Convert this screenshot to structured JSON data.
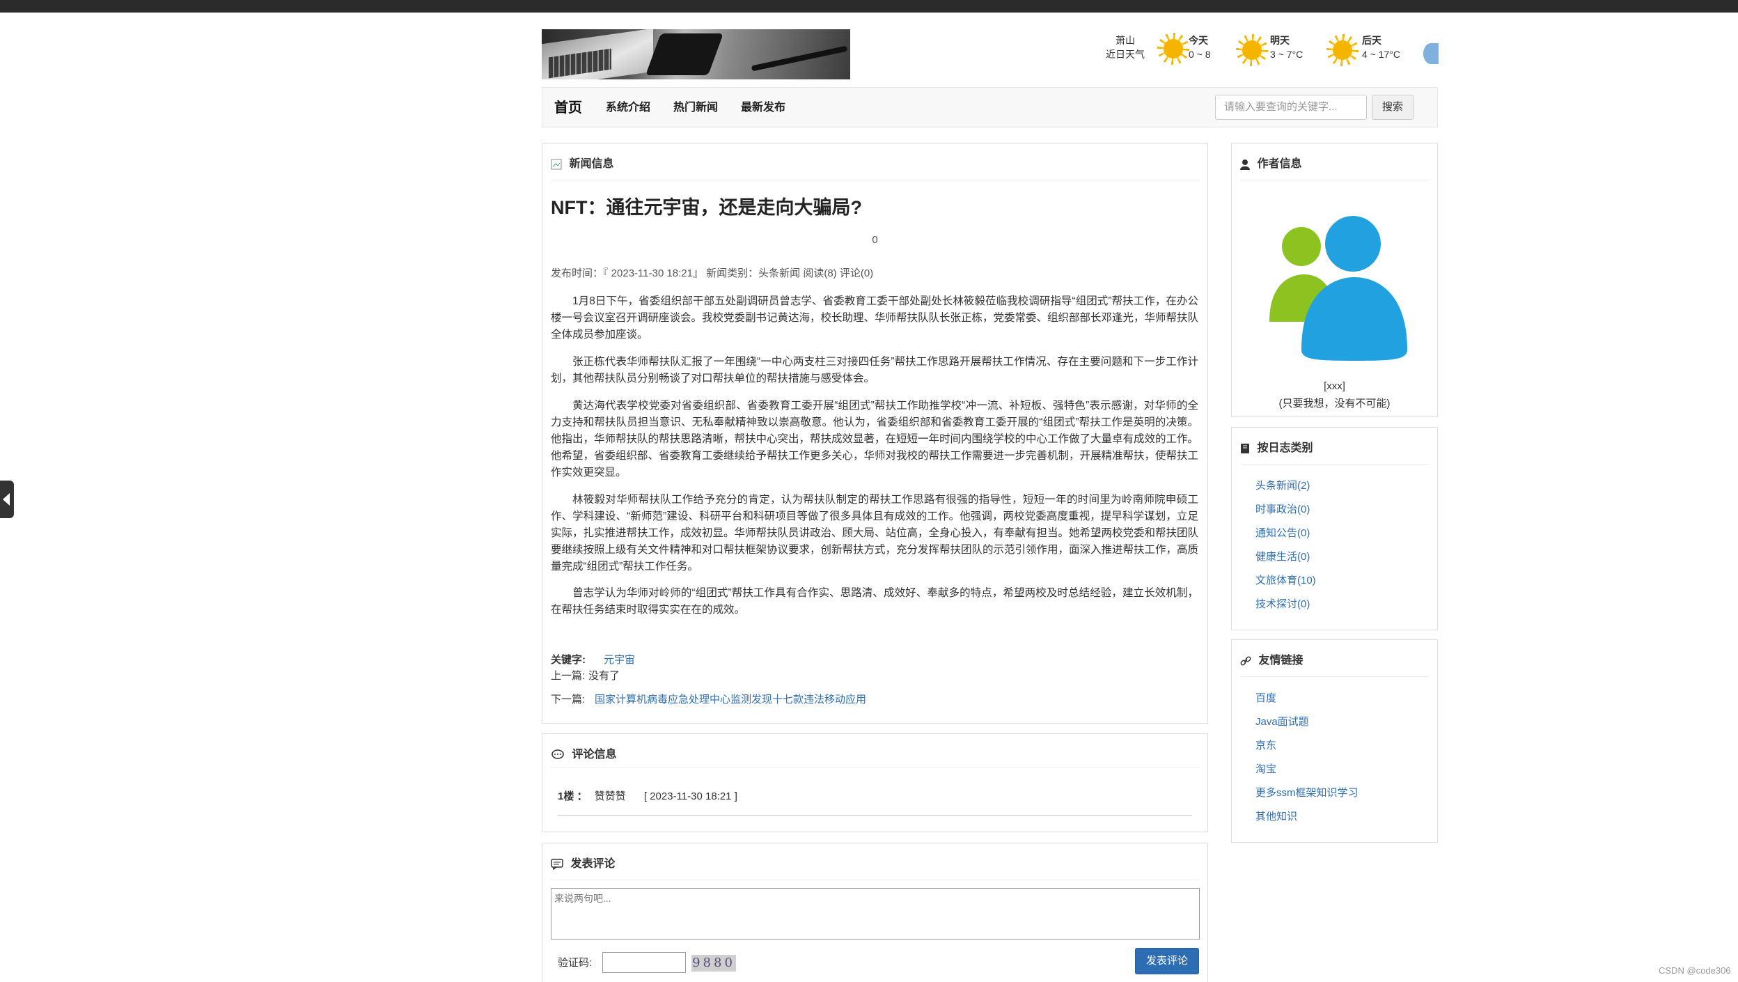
{
  "banner": {
    "alt": "laptop-phone-pen-banner"
  },
  "weather": {
    "city": "萧山",
    "city_sub": "近日天气",
    "days": [
      {
        "label": "今天",
        "temp": "0 ~ 8",
        "icon": "sun-icon"
      },
      {
        "label": "明天",
        "temp": "3 ~ 7°C",
        "icon": "sun-icon"
      },
      {
        "label": "后天",
        "temp": "4 ~ 17°C",
        "icon": "sun-icon"
      }
    ]
  },
  "nav": {
    "items": [
      "首页",
      "系统介绍",
      "热门新闻",
      "最新发布"
    ],
    "search_placeholder": "请输入要查询的关键字...",
    "search_button": "搜索"
  },
  "news": {
    "section_title": "新闻信息",
    "title": "NFT：通往元宇宙，还是走向大骗局?",
    "view_count": "0",
    "meta": "发布时间：『 2023-11-30 18:21』  新闻类别：头条新闻  阅读(8) 评论(0)",
    "paragraphs": [
      "1月8日下午，省委组织部干部五处副调研员曾志学、省委教育工委干部处副处长林筱毅莅临我校调研指导“组团式”帮扶工作，在办公楼一号会议室召开调研座谈会。我校党委副书记黄达海，校长助理、华师帮扶队队长张正栋，党委常委、组织部部长邓逢光，华师帮扶队全体成员参加座谈。",
      "张正栋代表华师帮扶队汇报了一年围绕“一中心两支柱三对接四任务”帮扶工作思路开展帮扶工作情况、存在主要问题和下一步工作计划，其他帮扶队员分别畅谈了对口帮扶单位的帮扶措施与感受体会。",
      "黄达海代表学校党委对省委组织部、省委教育工委开展“组团式”帮扶工作助推学校“冲一流、补短板、强特色”表示感谢，对华师的全力支持和帮扶队员担当意识、无私奉献精神致以崇高敬意。他认为，省委组织部和省委教育工委开展的“组团式”帮扶工作是英明的决策。他指出，华师帮扶队的帮扶思路清晰，帮扶中心突出，帮扶成效显著，在短短一年时间内围绕学校的中心工作做了大量卓有成效的工作。他希望，省委组织部、省委教育工委继续给予帮扶工作更多关心，华师对我校的帮扶工作需要进一步完善机制，开展精准帮扶，使帮扶工作实效更突显。",
      "林筱毅对华师帮扶队工作给予充分的肯定，认为帮扶队制定的帮扶工作思路有很强的指导性，短短一年的时间里为岭南师院申硕工作、学科建设、“新师范”建设、科研平台和科研项目等做了很多具体且有成效的工作。他强调，两校党委高度重视，提早科学谋划，立足实际，扎实推进帮扶工作，成效初显。华师帮扶队员讲政治、顾大局、站位高，全身心投入，有奉献有担当。她希望两校党委和帮扶团队要继续按照上级有关文件精神和对口帮扶框架协议要求，创新帮扶方式，充分发挥帮扶团队的示范引领作用，面深入推进帮扶工作，高质量完成“组团式”帮扶工作任务。",
      "曾志学认为华师对岭师的“组团式”帮扶工作具有合作实、思路清、成效好、奉献多的特点，希望两校及时总结经验，建立长效机制，在帮扶任务结束时取得实实在在的成效。"
    ],
    "keyword_label": "关键字:",
    "keyword": "元宇宙",
    "prev_label": "上一篇:",
    "prev_value": "没有了",
    "next_label": "下一篇:",
    "next_value": "国家计算机病毒应急处理中心监测发现十七款违法移动应用"
  },
  "comments": {
    "section_title": "评论信息",
    "items": [
      {
        "floor": "1楼 ：",
        "user": "赞赞赞",
        "time": "[ 2023-11-30 18:21 ]"
      }
    ]
  },
  "post_comment": {
    "section_title": "发表评论",
    "placeholder": "来说两句吧...",
    "captcha_label": "验证码:",
    "captcha_text": "9880",
    "submit": "发表评论"
  },
  "author": {
    "section_title": "作者信息",
    "name": "[xxx]",
    "motto": "(只要我想，没有不可能)"
  },
  "categories": {
    "section_title": "按日志类别",
    "items": [
      "头条新闻(2)",
      "时事政治(0)",
      "通知公告(0)",
      "健康生活(0)",
      "文旅体育(10)",
      "技术探讨(0)"
    ]
  },
  "links": {
    "section_title": "友情链接",
    "items": [
      "百度",
      "Java面试题",
      "京东",
      "淘宝",
      "更多ssm框架知识学习",
      "其他知识"
    ]
  },
  "watermark": "CSDN @code306",
  "colors": {
    "link": "#2f6fb3",
    "button": "#2c6db3",
    "sun": "#f5b400"
  }
}
